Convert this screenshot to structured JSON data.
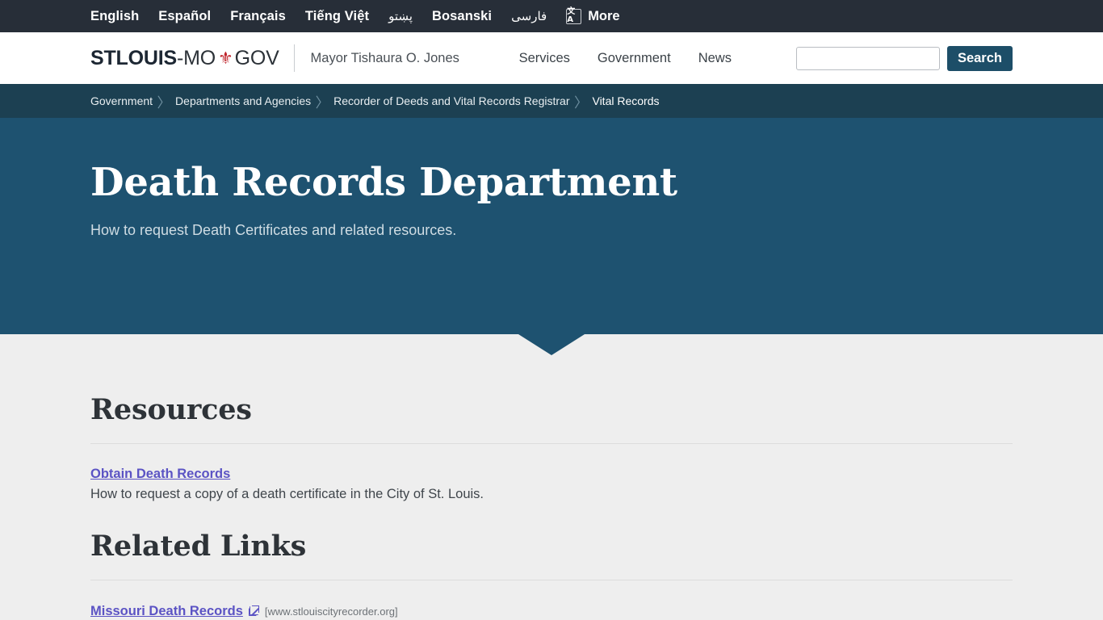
{
  "colors": {
    "lang_bar_bg": "#272e38",
    "masthead_bg": "#ffffff",
    "breadcrumb_bg": "#1c4052",
    "hero_bg": "#1e5270",
    "content_bg": "#eeeeee",
    "accent_red": "#bf232a",
    "link_purple": "#5b53c4",
    "search_button_bg": "#1d4e68"
  },
  "language_bar": {
    "items": [
      {
        "label": "English",
        "rtl": false
      },
      {
        "label": "Español",
        "rtl": false
      },
      {
        "label": "Français",
        "rtl": false
      },
      {
        "label": "Tiếng Việt",
        "rtl": false
      },
      {
        "label": "پښتو",
        "rtl": true
      },
      {
        "label": "Bosanski",
        "rtl": false
      },
      {
        "label": "فارسی",
        "rtl": true
      }
    ],
    "more_label": "More",
    "translate_icon": "translate-icon",
    "translate_glyph": "文A"
  },
  "masthead": {
    "logo": {
      "part1": "STLOUIS",
      "part2": "-MO",
      "fleur": "⚜",
      "part3": "GOV"
    },
    "mayor": "Mayor Tishaura O. Jones",
    "nav": [
      {
        "label": "Services"
      },
      {
        "label": "Government"
      },
      {
        "label": "News"
      }
    ],
    "search": {
      "value": "",
      "placeholder": "",
      "button_label": "Search"
    }
  },
  "breadcrumb": {
    "separator": "〉",
    "items": [
      {
        "label": "Government",
        "current": false
      },
      {
        "label": "Departments and Agencies",
        "current": false
      },
      {
        "label": "Recorder of Deeds and Vital Records Registrar",
        "current": false
      },
      {
        "label": "Vital Records",
        "current": true
      }
    ]
  },
  "hero": {
    "title": "Death Records Department",
    "subtitle": "How to request Death Certificates and related resources."
  },
  "sections": {
    "resources": {
      "heading": "Resources",
      "items": [
        {
          "link": "Obtain Death Records",
          "description": "How to request a copy of a death certificate in the City of St. Louis."
        }
      ]
    },
    "related_links": {
      "heading": "Related Links",
      "items": [
        {
          "link": "Missouri Death Records",
          "url_label": "[www.stlouiscityrecorder.org]"
        }
      ]
    }
  }
}
